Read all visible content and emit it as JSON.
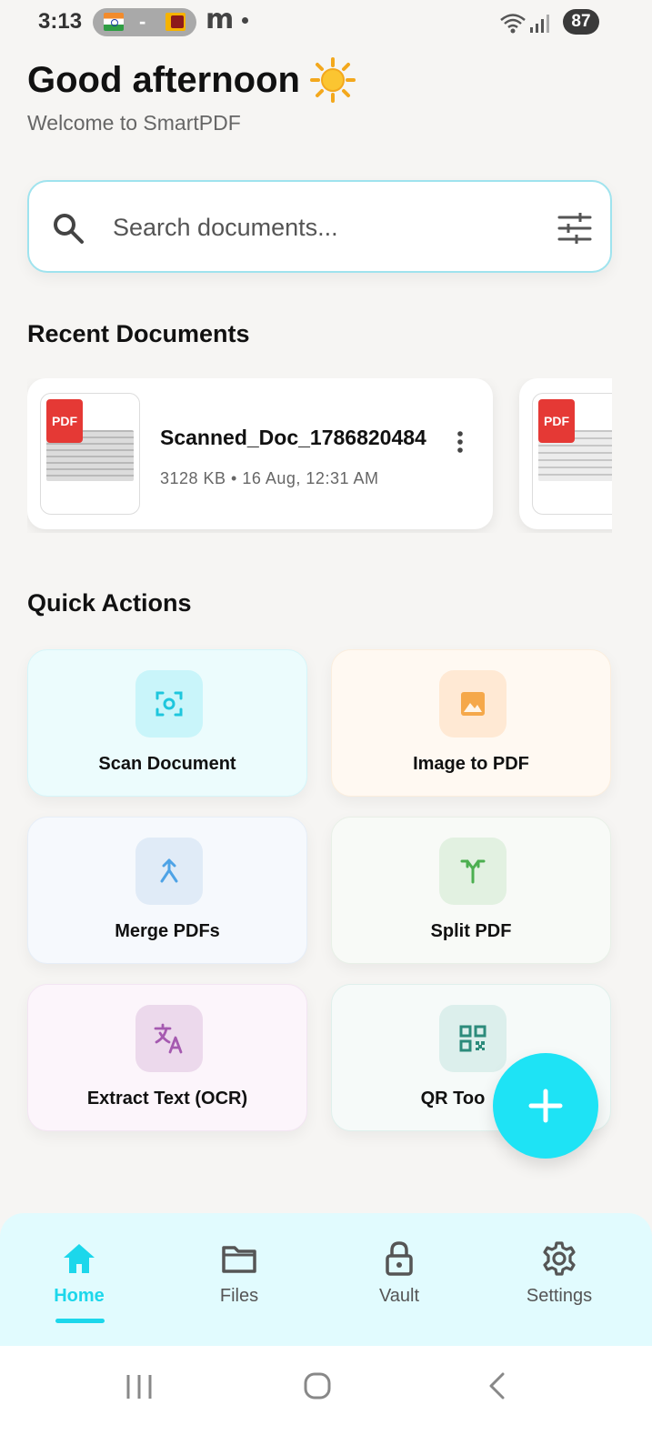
{
  "status_bar": {
    "time": "3:13",
    "separator": "-",
    "app_letter": "m",
    "battery": "87"
  },
  "header": {
    "greeting": "Good afternoon",
    "subtitle": "Welcome to SmartPDF"
  },
  "search": {
    "placeholder": "Search documents..."
  },
  "recent": {
    "title": "Recent Documents",
    "documents": [
      {
        "badge": "PDF",
        "name": "Scanned_Doc_1786820484",
        "meta": "3128 KB • 16 Aug, 12:31 AM"
      },
      {
        "badge": "PDF"
      }
    ]
  },
  "quick_actions": {
    "title": "Quick Actions",
    "items": [
      {
        "label": "Scan Document",
        "icon": "scan-icon",
        "bg": "#ecfcfd",
        "icon_bg": "#c9f5fa",
        "icon_color": "#1ec6dd"
      },
      {
        "label": "Image to PDF",
        "icon": "image-icon",
        "bg": "#fff9f2",
        "icon_bg": "#ffe9d4",
        "icon_color": "#f5a84a"
      },
      {
        "label": "Merge PDFs",
        "icon": "merge-icon",
        "bg": "#f6f9fd",
        "icon_bg": "#e0ebf7",
        "icon_color": "#4ea3e6"
      },
      {
        "label": "Split PDF",
        "icon": "split-icon",
        "bg": "#f8faf7",
        "icon_bg": "#e2f1e1",
        "icon_color": "#4caf50"
      },
      {
        "label": "Extract Text (OCR)",
        "icon": "translate-icon",
        "bg": "#fcf5fb",
        "icon_bg": "#ecd9ec",
        "icon_color": "#a55ab0"
      },
      {
        "label": "QR Too",
        "icon": "qr-icon",
        "bg": "#f6faf9",
        "icon_bg": "#dcefec",
        "icon_color": "#2c8b7b"
      }
    ]
  },
  "fab": {
    "icon": "plus-icon"
  },
  "bottom_nav": {
    "items": [
      {
        "label": "Home",
        "icon": "home-icon",
        "active": true
      },
      {
        "label": "Files",
        "icon": "folder-icon"
      },
      {
        "label": "Vault",
        "icon": "lock-icon"
      },
      {
        "label": "Settings",
        "icon": "gear-icon"
      }
    ]
  },
  "colors": {
    "accent": "#1cd7eb",
    "background": "#f6f5f3"
  }
}
